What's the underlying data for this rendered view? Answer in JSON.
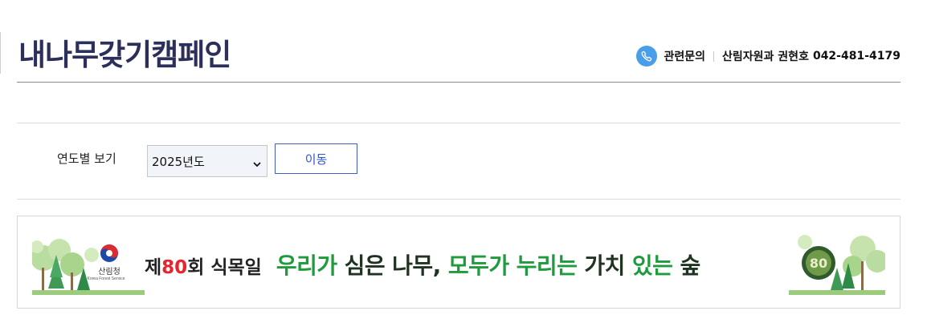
{
  "page": {
    "title": "내나무갖기캠페인"
  },
  "contact": {
    "label": "관련문의",
    "department_person": "산림자원과 권현호",
    "phone": "042-481-4179",
    "icon": "phone-icon",
    "icon_color": "#4a9de8"
  },
  "filter": {
    "label": "연도별 보기",
    "selected_year": "2025년도",
    "move_button_label": "이동",
    "button_color": "#3e5ec4"
  },
  "banner": {
    "agency_name": "산림청",
    "agency_name_en": "Korea Forest Service",
    "event_prefix": "제",
    "event_number": "80",
    "event_suffix": "회 식목일",
    "slogan_parts": [
      {
        "text": "우리가",
        "tone": "green"
      },
      {
        "text": "심은",
        "tone": "dark"
      },
      {
        "text": "나무,",
        "tone": "dark"
      },
      {
        "text": "모두가",
        "tone": "green"
      },
      {
        "text": "누리는",
        "tone": "green"
      },
      {
        "text": "가치",
        "tone": "dark"
      },
      {
        "text": "있는",
        "tone": "green"
      },
      {
        "text": "숲",
        "tone": "dark"
      }
    ],
    "badge_number": "80",
    "colors": {
      "green": "#1f9a3c",
      "dark": "#1f3320",
      "red": "#e8242c"
    }
  }
}
